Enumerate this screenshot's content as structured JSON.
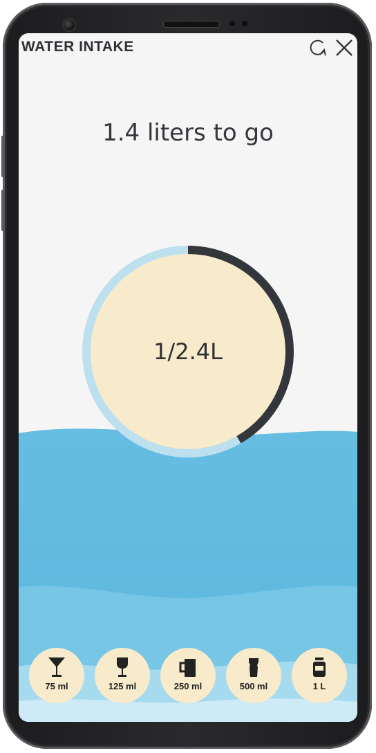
{
  "header": {
    "title": "WATER INTAKE",
    "icons": [
      "refresh-icon",
      "close-icon"
    ]
  },
  "goal": {
    "remaining_text": "1.4 liters to go"
  },
  "progress": {
    "label": "1/2.4L",
    "consumed_liters": 1,
    "target_liters": 2.4,
    "fraction": 0.4167
  },
  "cups": [
    {
      "label": "75 ml",
      "icon": "cocktail-glass-icon"
    },
    {
      "label": "125 ml",
      "icon": "wine-glass-icon"
    },
    {
      "label": "250 ml",
      "icon": "mug-icon"
    },
    {
      "label": "500 ml",
      "icon": "pint-glass-icon"
    },
    {
      "label": "1 L",
      "icon": "bottle-icon"
    }
  ],
  "colors": {
    "background": "#f5f5f5",
    "water": "#69bfe2",
    "ring_track": "#bde0ef",
    "ring_progress": "#33363b",
    "circle_fill": "#f7ebcb",
    "text": "#33363b"
  }
}
